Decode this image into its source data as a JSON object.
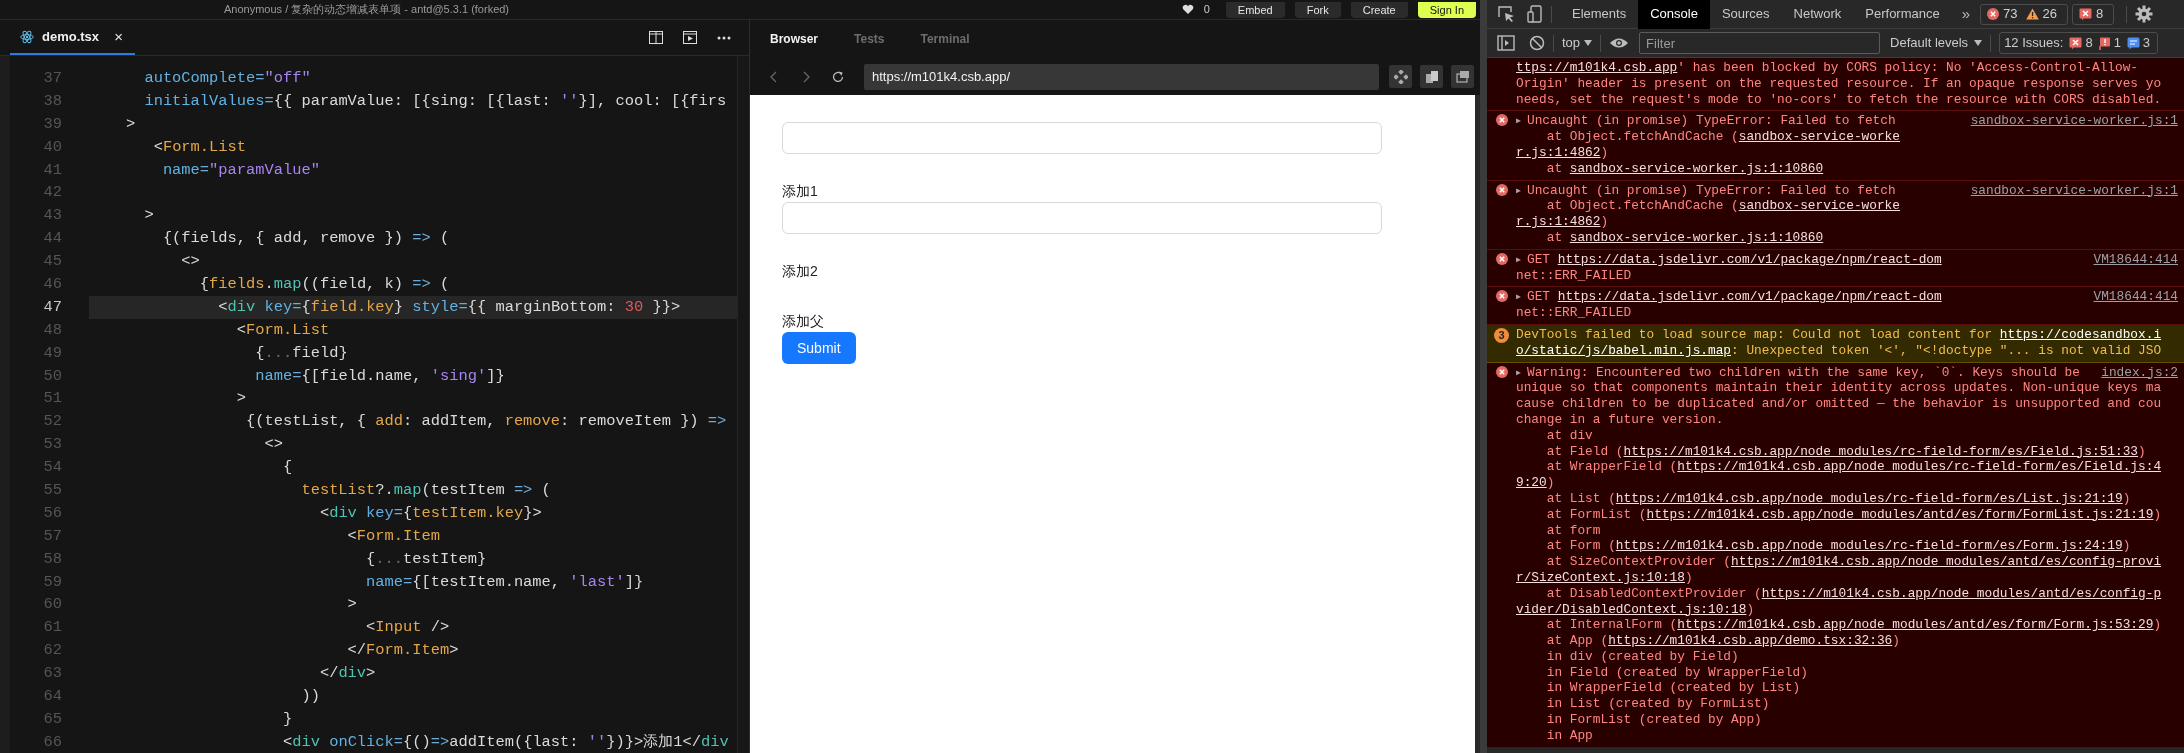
{
  "header": {
    "title": "Anonymous / 复杂的动态增减表单项 - antd@5.3.1 (forked)",
    "likes": "0",
    "buttons": [
      {
        "label": "Embed",
        "kind": "secondary"
      },
      {
        "label": "Fork",
        "kind": "secondary"
      },
      {
        "label": "Create",
        "kind": "secondary"
      },
      {
        "label": "Sign In",
        "kind": "primary"
      }
    ]
  },
  "editor": {
    "tab": {
      "label": "demo.tsx",
      "close": "×",
      "selected": true
    },
    "lines": [
      {
        "number": "37",
        "current": false,
        "tokens": [
          {
            "kind": "attr",
            "text": "      autoComplete"
          },
          {
            "kind": "op",
            "text": "="
          },
          {
            "kind": "str",
            "text": "\"off\""
          }
        ]
      },
      {
        "number": "38",
        "current": false,
        "tokens": [
          {
            "kind": "attr",
            "text": "      initialValues"
          },
          {
            "kind": "op",
            "text": "="
          },
          {
            "kind": "plain",
            "text": "{{ paramValue: [{sing: [{last: "
          },
          {
            "kind": "str",
            "text": "''"
          },
          {
            "kind": "plain",
            "text": "}], cool: [{firs"
          }
        ]
      },
      {
        "number": "39",
        "current": false,
        "tokens": [
          {
            "kind": "plain",
            "text": "    >"
          }
        ]
      },
      {
        "number": "40",
        "current": false,
        "tokens": [
          {
            "kind": "plain",
            "text": "       <"
          },
          {
            "kind": "comp",
            "text": "Form.List"
          }
        ]
      },
      {
        "number": "41",
        "current": false,
        "tokens": [
          {
            "kind": "attr",
            "text": "        name"
          },
          {
            "kind": "op",
            "text": "="
          },
          {
            "kind": "str",
            "text": "\"paramValue\""
          }
        ]
      },
      {
        "number": "42",
        "current": false
      },
      {
        "number": "43",
        "current": false,
        "tokens": [
          {
            "kind": "plain",
            "text": "      >"
          }
        ]
      },
      {
        "number": "44",
        "current": false,
        "tokens": [
          {
            "kind": "plain",
            "text": "        {(fields, { add, remove }) "
          },
          {
            "kind": "op",
            "text": "=>"
          },
          {
            "kind": "plain",
            "text": " ("
          }
        ]
      },
      {
        "number": "45",
        "current": false,
        "tokens": [
          {
            "kind": "plain",
            "text": "          <>"
          }
        ]
      },
      {
        "number": "46",
        "current": false,
        "tokens": [
          {
            "kind": "plain",
            "text": "            {"
          },
          {
            "kind": "comp",
            "text": "fields"
          },
          {
            "kind": "plain",
            "text": "."
          },
          {
            "kind": "tag",
            "text": "map"
          },
          {
            "kind": "plain",
            "text": "((field, k) "
          },
          {
            "kind": "op",
            "text": "=>"
          },
          {
            "kind": "plain",
            "text": " ("
          }
        ]
      },
      {
        "number": "47",
        "current": true,
        "tokens": [
          {
            "kind": "plain",
            "text": "              <"
          },
          {
            "kind": "tag",
            "text": "div"
          },
          {
            "kind": "attr",
            "text": " key"
          },
          {
            "kind": "op",
            "text": "="
          },
          {
            "kind": "plain",
            "text": "{"
          },
          {
            "kind": "comp",
            "text": "field.key"
          },
          {
            "kind": "plain",
            "text": "} "
          },
          {
            "kind": "attr",
            "text": "style"
          },
          {
            "kind": "op",
            "text": "="
          },
          {
            "kind": "plain",
            "text": "{{ marginBottom: "
          },
          {
            "kind": "num",
            "text": "30"
          },
          {
            "kind": "plain",
            "text": " }}>"
          }
        ]
      },
      {
        "number": "48",
        "current": false,
        "tokens": [
          {
            "kind": "plain",
            "text": "                <"
          },
          {
            "kind": "comp",
            "text": "Form.List"
          }
        ]
      },
      {
        "number": "49",
        "current": false,
        "tokens": [
          {
            "kind": "plain",
            "text": "                  {"
          },
          {
            "kind": "dim",
            "text": "..."
          },
          {
            "kind": "plain",
            "text": "field}"
          }
        ]
      },
      {
        "number": "50",
        "current": false,
        "tokens": [
          {
            "kind": "attr",
            "text": "                  name"
          },
          {
            "kind": "op",
            "text": "="
          },
          {
            "kind": "plain",
            "text": "{[field.name, "
          },
          {
            "kind": "str",
            "text": "'sing'"
          },
          {
            "kind": "plain",
            "text": "]}"
          }
        ]
      },
      {
        "number": "51",
        "current": false,
        "tokens": [
          {
            "kind": "plain",
            "text": "                >"
          }
        ]
      },
      {
        "number": "52",
        "current": false,
        "tokens": [
          {
            "kind": "plain",
            "text": "                 {(testList, { "
          },
          {
            "kind": "comp",
            "text": "add"
          },
          {
            "kind": "plain",
            "text": ": addItem, "
          },
          {
            "kind": "comp",
            "text": "remove"
          },
          {
            "kind": "plain",
            "text": ": removeItem }) "
          },
          {
            "kind": "op",
            "text": "=>"
          }
        ]
      },
      {
        "number": "53",
        "current": false,
        "tokens": [
          {
            "kind": "plain",
            "text": "                   <>"
          }
        ]
      },
      {
        "number": "54",
        "current": false,
        "tokens": [
          {
            "kind": "plain",
            "text": "                     {"
          }
        ]
      },
      {
        "number": "55",
        "current": false,
        "tokens": [
          {
            "kind": "comp",
            "text": "                       testList"
          },
          {
            "kind": "plain",
            "text": "?."
          },
          {
            "kind": "tag",
            "text": "map"
          },
          {
            "kind": "plain",
            "text": "(testItem "
          },
          {
            "kind": "op",
            "text": "=>"
          },
          {
            "kind": "plain",
            "text": " ("
          }
        ]
      },
      {
        "number": "56",
        "current": false,
        "tokens": [
          {
            "kind": "plain",
            "text": "                         <"
          },
          {
            "kind": "tag",
            "text": "div"
          },
          {
            "kind": "attr",
            "text": " key"
          },
          {
            "kind": "op",
            "text": "="
          },
          {
            "kind": "plain",
            "text": "{"
          },
          {
            "kind": "comp",
            "text": "testItem.key"
          },
          {
            "kind": "plain",
            "text": "}>"
          }
        ]
      },
      {
        "number": "57",
        "current": false,
        "tokens": [
          {
            "kind": "plain",
            "text": "                            <"
          },
          {
            "kind": "comp",
            "text": "Form.Item"
          }
        ]
      },
      {
        "number": "58",
        "current": false,
        "tokens": [
          {
            "kind": "plain",
            "text": "                              {"
          },
          {
            "kind": "dim",
            "text": "..."
          },
          {
            "kind": "plain",
            "text": "testItem}"
          }
        ]
      },
      {
        "number": "59",
        "current": false,
        "tokens": [
          {
            "kind": "attr",
            "text": "                              name"
          },
          {
            "kind": "op",
            "text": "="
          },
          {
            "kind": "plain",
            "text": "{[testItem.name, "
          },
          {
            "kind": "str",
            "text": "'last'"
          },
          {
            "kind": "plain",
            "text": "]}"
          }
        ]
      },
      {
        "number": "60",
        "current": false,
        "tokens": [
          {
            "kind": "plain",
            "text": "                            >"
          }
        ]
      },
      {
        "number": "61",
        "current": false,
        "tokens": [
          {
            "kind": "plain",
            "text": "                              <"
          },
          {
            "kind": "comp",
            "text": "Input"
          },
          {
            "kind": "plain",
            "text": " />"
          }
        ]
      },
      {
        "number": "62",
        "current": false,
        "tokens": [
          {
            "kind": "plain",
            "text": "                            </"
          },
          {
            "kind": "comp",
            "text": "Form.Item"
          },
          {
            "kind": "plain",
            "text": ">"
          }
        ]
      },
      {
        "number": "63",
        "current": false,
        "tokens": [
          {
            "kind": "plain",
            "text": "                         </"
          },
          {
            "kind": "tag",
            "text": "div"
          },
          {
            "kind": "plain",
            "text": ">"
          }
        ]
      },
      {
        "number": "64",
        "current": false,
        "tokens": [
          {
            "kind": "plain",
            "text": "                       ))"
          }
        ]
      },
      {
        "number": "65",
        "current": false,
        "tokens": [
          {
            "kind": "plain",
            "text": "                     }"
          }
        ]
      },
      {
        "number": "66",
        "current": false,
        "tokens": [
          {
            "kind": "plain",
            "text": "                     <"
          },
          {
            "kind": "tag",
            "text": "div"
          },
          {
            "kind": "attr",
            "text": " onClick"
          },
          {
            "kind": "op",
            "text": "="
          },
          {
            "kind": "plain",
            "text": "{()"
          },
          {
            "kind": "op",
            "text": "=>"
          },
          {
            "kind": "plain",
            "text": "addItem({last: "
          },
          {
            "kind": "str",
            "text": "''"
          },
          {
            "kind": "plain",
            "text": "})}>添加1</"
          },
          {
            "kind": "tag",
            "text": "div"
          }
        ]
      }
    ]
  },
  "browser": {
    "tabs": [
      {
        "label": "Browser",
        "selected": true
      },
      {
        "label": "Tests",
        "selected": false
      },
      {
        "label": "Terminal",
        "selected": false
      }
    ],
    "url": "https://m101k4.csb.app/",
    "items": [
      {
        "kind": "input"
      },
      {
        "kind": "link",
        "text": "添加1"
      },
      {
        "kind": "input"
      },
      {
        "kind": "link",
        "text": "添加2"
      },
      {
        "kind": "link",
        "text": "添加父"
      },
      {
        "kind": "button",
        "text": "Submit"
      }
    ]
  },
  "devtools": {
    "tabs": [
      {
        "label": "Elements",
        "selected": false
      },
      {
        "label": "Console",
        "selected": true
      },
      {
        "label": "Sources",
        "selected": false
      },
      {
        "label": "Network",
        "selected": false
      },
      {
        "label": "Performance",
        "selected": false
      }
    ],
    "more": "»",
    "badges": [
      {
        "kind": "error",
        "count": "73"
      },
      {
        "kind": "warning",
        "count": "26"
      }
    ],
    "issue_badge": {
      "kind": "issue",
      "count": "8"
    },
    "context": "top",
    "filter_placeholder": "Filter",
    "levels": "Default levels",
    "issues": {
      "label": "12 Issues:",
      "counts": [
        {
          "kind": "error",
          "count": "8"
        },
        {
          "kind": "warning",
          "count": "1"
        },
        {
          "kind": "info",
          "count": "3"
        }
      ]
    },
    "messages": [
      {
        "kind": "error",
        "continued": true,
        "lines": [
          [
            {
              "kind": "link",
              "text": "ttps://m101k4.csb.app"
            },
            {
              "kind": "text",
              "text": "' has been blocked by CORS policy: No 'Access-Control-Allow-"
            }
          ],
          [
            {
              "kind": "text",
              "text": "Origin' header is present on the requested resource. If an opaque response serves yo"
            }
          ],
          [
            {
              "kind": "text",
              "text": "needs, set the request's mode to 'no-cors' to fetch the resource with CORS disabled."
            }
          ]
        ]
      },
      {
        "kind": "error",
        "continued": false,
        "arrow": "▶",
        "source": "sandbox-service-worker.js:1",
        "lines": [
          [
            {
              "kind": "text",
              "text": "Uncaught (in promise) TypeError: Failed to fetch"
            }
          ],
          [
            {
              "kind": "text",
              "text": "    at Object.fetchAndCache ("
            },
            {
              "kind": "link",
              "text": "sandbox-service-worke"
            }
          ],
          [
            {
              "kind": "link",
              "text": "r.js:1:4862"
            },
            {
              "kind": "text",
              "text": ")"
            }
          ],
          [
            {
              "kind": "text",
              "text": "    at "
            },
            {
              "kind": "link",
              "text": "sandbox-service-worker.js:1:10860"
            }
          ]
        ]
      },
      {
        "kind": "error",
        "continued": false,
        "arrow": "▶",
        "source": "sandbox-service-worker.js:1",
        "lines": [
          [
            {
              "kind": "text",
              "text": "Uncaught (in promise) TypeError: Failed to fetch"
            }
          ],
          [
            {
              "kind": "text",
              "text": "    at Object.fetchAndCache ("
            },
            {
              "kind": "link",
              "text": "sandbox-service-worke"
            }
          ],
          [
            {
              "kind": "link",
              "text": "r.js:1:4862"
            },
            {
              "kind": "text",
              "text": ")"
            }
          ],
          [
            {
              "kind": "text",
              "text": "    at "
            },
            {
              "kind": "link",
              "text": "sandbox-service-worker.js:1:10860"
            }
          ]
        ]
      },
      {
        "kind": "error",
        "continued": false,
        "arrow": "▶",
        "source": "VM18644:414",
        "lines": [
          [
            {
              "kind": "text",
              "text": "GET "
            },
            {
              "kind": "link",
              "text": "https://data.jsdelivr.com/v1/package/npm/react-dom"
            }
          ],
          [
            {
              "kind": "text",
              "text": "net::ERR_FAILED"
            }
          ]
        ]
      },
      {
        "kind": "error",
        "continued": false,
        "arrow": "▶",
        "source": "VM18644:414",
        "lines": [
          [
            {
              "kind": "text",
              "text": "GET "
            },
            {
              "kind": "link",
              "text": "https://data.jsdelivr.com/v1/package/npm/react-dom"
            }
          ],
          [
            {
              "kind": "text",
              "text": "net::ERR_FAILED"
            }
          ]
        ]
      },
      {
        "kind": "warning",
        "continued": false,
        "count": "3",
        "lines": [
          [
            {
              "kind": "text",
              "text": "DevTools failed to load source map: Could not load content for "
            },
            {
              "kind": "link",
              "text": "https://codesandbox.i"
            }
          ],
          [
            {
              "kind": "link",
              "text": "o/static/js/babel.min.js.map"
            },
            {
              "kind": "text",
              "text": ": Unexpected token '<', \"<!doctype \"... is not valid JSO"
            }
          ]
        ]
      },
      {
        "kind": "error",
        "continued": false,
        "arrow": "▶",
        "source": "index.js:2",
        "lines": [
          [
            {
              "kind": "text",
              "text": "Warning: Encountered two children with the same key, `0`. Keys should be"
            }
          ],
          [
            {
              "kind": "text",
              "text": "unique so that components maintain their identity across updates. Non-unique keys ma"
            }
          ],
          [
            {
              "kind": "text",
              "text": "cause children to be duplicated and/or omitted — the behavior is unsupported and cou"
            }
          ],
          [
            {
              "kind": "text",
              "text": "change in a future version."
            }
          ],
          [
            {
              "kind": "text",
              "text": "    at div"
            }
          ],
          [
            {
              "kind": "text",
              "text": "    at Field ("
            },
            {
              "kind": "link",
              "text": "https://m101k4.csb.app/node_modules/rc-field-form/es/Field.js:51:33"
            },
            {
              "kind": "text",
              "text": ")"
            }
          ],
          [
            {
              "kind": "text",
              "text": "    at WrapperField ("
            },
            {
              "kind": "link",
              "text": "https://m101k4.csb.app/node_modules/rc-field-form/es/Field.js:4"
            }
          ],
          [
            {
              "kind": "link",
              "text": "9:20"
            },
            {
              "kind": "text",
              "text": ")"
            }
          ],
          [
            {
              "kind": "text",
              "text": "    at List ("
            },
            {
              "kind": "link",
              "text": "https://m101k4.csb.app/node_modules/rc-field-form/es/List.js:21:19"
            },
            {
              "kind": "text",
              "text": ")"
            }
          ],
          [
            {
              "kind": "text",
              "text": "    at FormList ("
            },
            {
              "kind": "link",
              "text": "https://m101k4.csb.app/node_modules/antd/es/form/FormList.js:21:19"
            },
            {
              "kind": "text",
              "text": ")"
            }
          ],
          [
            {
              "kind": "text",
              "text": "    at form"
            }
          ],
          [
            {
              "kind": "text",
              "text": "    at Form ("
            },
            {
              "kind": "link",
              "text": "https://m101k4.csb.app/node_modules/rc-field-form/es/Form.js:24:19"
            },
            {
              "kind": "text",
              "text": ")"
            }
          ],
          [
            {
              "kind": "text",
              "text": "    at SizeContextProvider ("
            },
            {
              "kind": "link",
              "text": "https://m101k4.csb.app/node_modules/antd/es/config-provi"
            }
          ],
          [
            {
              "kind": "link",
              "text": "r/SizeContext.js:10:18"
            },
            {
              "kind": "text",
              "text": ")"
            }
          ],
          [
            {
              "kind": "text",
              "text": "    at DisabledContextProvider ("
            },
            {
              "kind": "link",
              "text": "https://m101k4.csb.app/node_modules/antd/es/config-p"
            }
          ],
          [
            {
              "kind": "link",
              "text": "vider/DisabledContext.js:10:18"
            },
            {
              "kind": "text",
              "text": ")"
            }
          ],
          [
            {
              "kind": "text",
              "text": "    at InternalForm ("
            },
            {
              "kind": "link",
              "text": "https://m101k4.csb.app/node_modules/antd/es/form/Form.js:53:29"
            },
            {
              "kind": "text",
              "text": ")"
            }
          ],
          [
            {
              "kind": "text",
              "text": "    at App ("
            },
            {
              "kind": "link",
              "text": "https://m101k4.csb.app/demo.tsx:32:36"
            },
            {
              "kind": "text",
              "text": ")"
            }
          ],
          [
            {
              "kind": "text",
              "text": "    in div (created by Field)"
            }
          ],
          [
            {
              "kind": "text",
              "text": "    in Field (created by WrapperField)"
            }
          ],
          [
            {
              "kind": "text",
              "text": "    in WrapperField (created by List)"
            }
          ],
          [
            {
              "kind": "text",
              "text": "    in List (created by FormList)"
            }
          ],
          [
            {
              "kind": "text",
              "text": "    in FormList (created by App)"
            }
          ],
          [
            {
              "kind": "text",
              "text": "    in App"
            }
          ]
        ]
      }
    ]
  }
}
